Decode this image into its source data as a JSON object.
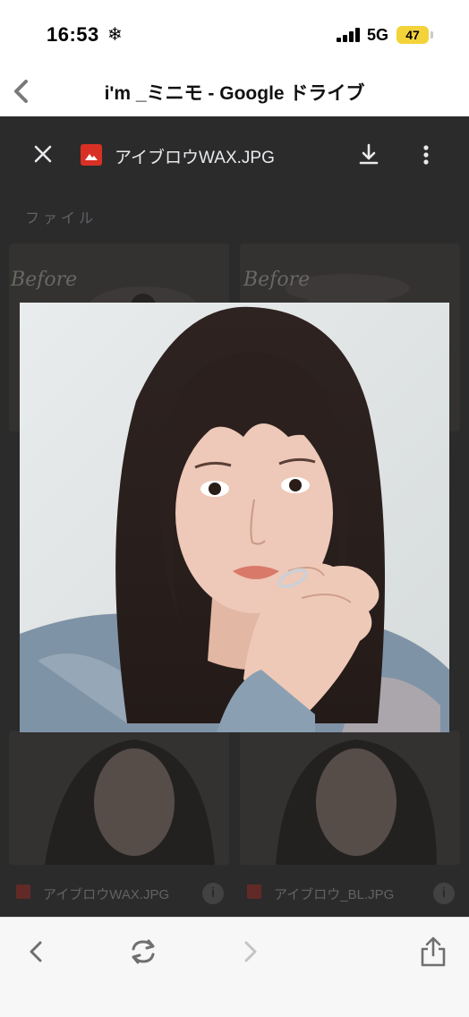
{
  "status_bar": {
    "time": "16:53",
    "snow_glyph": "❄",
    "network": "5G",
    "battery": "47"
  },
  "title_bar": {
    "title": "i'm _ミニモ - Google ドライブ",
    "back_icon": "chevron-left-icon"
  },
  "viewer": {
    "file_name": "アイブロウWAX.JPG",
    "close_icon": "close-icon",
    "download_icon": "download-icon",
    "more_icon": "more-vert-icon"
  },
  "background_page": {
    "section_label": "ファイル",
    "before_label": "Before",
    "files": [
      {
        "name": "アイブロウWAX.JPG"
      },
      {
        "name": "アイブロウ_BL.JPG"
      }
    ],
    "info_glyph": "i"
  },
  "bottom_bar": {
    "back_icon": "back-arrow-icon",
    "reload_icon": "reload-icon",
    "forward_icon": "forward-arrow-icon",
    "share_icon": "share-icon"
  },
  "colors": {
    "viewer_bg": "#2b2b2b",
    "file_icon_red": "#d93025",
    "battery_yellow": "#f3d33a"
  }
}
